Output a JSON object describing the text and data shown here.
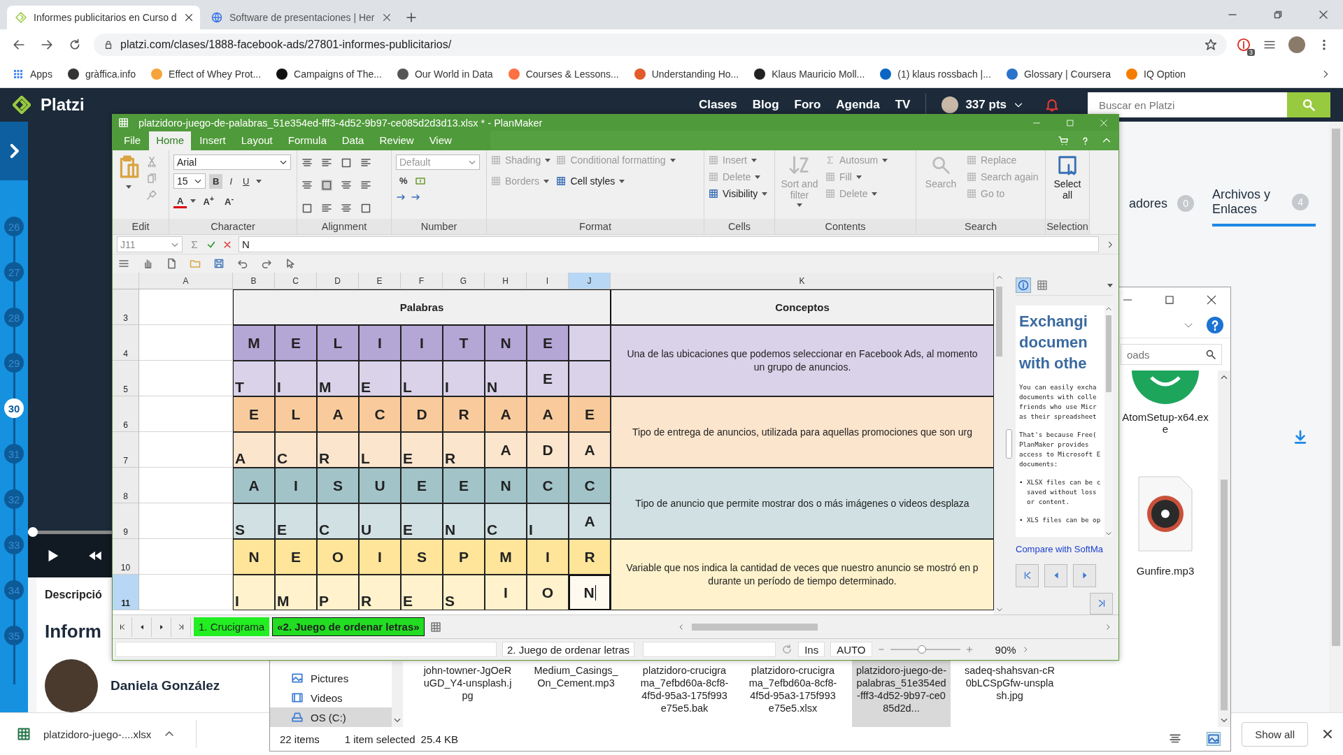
{
  "browser": {
    "tabs": [
      {
        "title": "Informes publicitarios en Curso d",
        "selected": true
      },
      {
        "title": "Software de presentaciones | Her",
        "selected": false
      }
    ],
    "address": "platzi.com/clases/1888-facebook-ads/27801-informes-publicitarios/",
    "extension_badge": "3",
    "bookmarks": [
      "Apps",
      "gràffica.info",
      "Effect of Whey Prot...",
      "Campaigns of The...",
      "Our World in Data",
      "Courses & Lessons...",
      "Understanding Ho...",
      "Klaus Mauricio Moll...",
      "(1) klaus rossbach |...",
      "Glossary | Coursera",
      "IQ Option"
    ]
  },
  "platzi": {
    "logo": "Platzi",
    "nav": [
      "Clases",
      "Blog",
      "Foro",
      "Agenda",
      "TV"
    ],
    "points": "337 pts",
    "search_placeholder": "Buscar en Platzi",
    "lessons": [
      {
        "number": "26",
        "selected": false
      },
      {
        "number": "27",
        "selected": false
      },
      {
        "number": "28",
        "selected": false
      },
      {
        "number": "29",
        "selected": false
      },
      {
        "number": "30",
        "selected": true
      },
      {
        "number": "31",
        "selected": false
      },
      {
        "number": "32",
        "selected": false
      },
      {
        "number": "33",
        "selected": false
      },
      {
        "number": "34",
        "selected": false
      },
      {
        "number": "35",
        "selected": false
      }
    ],
    "video_progress": {
      "level": 0.0
    },
    "description_tab": "Descripció",
    "title": "Inform",
    "author": "Daniela González",
    "side_tabs": [
      {
        "label": "adores",
        "count": "0",
        "selected": false
      },
      {
        "label": "Archivos y Enlaces",
        "count": "4",
        "selected": true
      }
    ]
  },
  "downloads": {
    "file": "platzidoro-juego-....xlsx",
    "show_all": "Show all"
  },
  "explorer": {
    "search_placeholder": "oads",
    "nav": [
      {
        "label": "Pictures",
        "selected": false
      },
      {
        "label": "Videos",
        "selected": false
      },
      {
        "label": "OS (C:)",
        "selected": true
      }
    ],
    "side_files": [
      {
        "name": "AtomSetup-x64.exe",
        "kind": "app"
      },
      {
        "name": "Gunfire.mp3",
        "kind": "audio"
      }
    ],
    "files": [
      {
        "name": "john-towner-JgOeRuGD_Y4-unsplash.jpg",
        "selected": false
      },
      {
        "name": "Medium_Casings_On_Cement.mp3",
        "selected": false
      },
      {
        "name": "platzidoro-crucigrama_7efbd60a-8cf8-4f5d-95a3-175f993e75e5.bak",
        "selected": false
      },
      {
        "name": "platzidoro-crucigrama_7efbd60a-8cf8-4f5d-95a3-175f993e75e5.xlsx",
        "selected": false
      },
      {
        "name": "platzidoro-juego-de-palabras_51e354ed-fff3-4d52-9b97-ce085d2d...",
        "selected": true
      },
      {
        "name": "sadeq-shahsvan-cR0bLCSpGfw-unsplash.jpg",
        "selected": false
      }
    ],
    "count": "22 items",
    "selection": "1 item selected",
    "size": "25.4 KB"
  },
  "planmaker": {
    "title": "platzidoro-juego-de-palabras_51e354ed-fff3-4d52-9b97-ce085d2d3d13.xlsx * - PlanMaker",
    "menu": [
      {
        "label": "File",
        "selected": false
      },
      {
        "label": "Home",
        "selected": true
      },
      {
        "label": "Insert",
        "selected": false
      },
      {
        "label": "Layout",
        "selected": false
      },
      {
        "label": "Formula",
        "selected": false
      },
      {
        "label": "Data",
        "selected": false
      },
      {
        "label": "Review",
        "selected": false
      },
      {
        "label": "View",
        "selected": false
      }
    ],
    "ribbon_groups": [
      {
        "kind": "edit",
        "label": "Edit"
      },
      {
        "kind": "character",
        "label": "Character",
        "font": "Arial",
        "size": "15",
        "styles": [
          {
            "label": "B",
            "selected": true
          },
          {
            "label": "I",
            "selected": false
          },
          {
            "label": "U",
            "selected": false
          }
        ],
        "font_color": "A",
        "grow": "A$^{+}$",
        "shrink": "A$^{-}$"
      },
      {
        "kind": "alignment",
        "label": "Alignment"
      },
      {
        "kind": "number",
        "label": "Number",
        "format": "Default",
        "percent": "%"
      },
      {
        "kind": "commands",
        "label": "Format",
        "columns": [
          [
            {
              "label": "Shading",
              "disabled": true,
              "dropdown": true
            },
            {
              "label": "Borders",
              "disabled": true,
              "dropdown": true
            }
          ],
          [
            {
              "label": "Conditional formatting",
              "disabled": true,
              "dropdown": true
            },
            {
              "label": "Cell styles",
              "disabled": false,
              "dropdown": true
            }
          ]
        ]
      },
      {
        "kind": "commands",
        "label": "Cells",
        "columns": [
          [
            {
              "label": "Insert",
              "disabled": true,
              "dropdown": true
            },
            {
              "label": "Delete",
              "disabled": true,
              "dropdown": true
            },
            {
              "label": "Visibility",
              "disabled": false,
              "dropdown": true
            }
          ]
        ]
      },
      {
        "kind": "commands",
        "label": "Contents",
        "large": {
          "label": "Sort and filter",
          "disabled": true,
          "dropdown": true
        },
        "columns": [
          [
            {
              "label": "Autosum",
              "disabled": true,
              "dropdown": true
            },
            {
              "label": "Fill",
              "disabled": true,
              "dropdown": true
            },
            {
              "label": "Delete",
              "disabled": true,
              "dropdown": true
            }
          ]
        ]
      },
      {
        "kind": "commands",
        "label": "Search",
        "large": {
          "label": "Search",
          "disabled": true,
          "dropdown": false
        },
        "columns": [
          [
            {
              "label": "Replace",
              "disabled": true,
              "dropdown": false
            },
            {
              "label": "Search again",
              "disabled": true,
              "dropdown": false
            },
            {
              "label": "Go to",
              "disabled": true,
              "dropdown": false
            }
          ]
        ]
      },
      {
        "kind": "commands",
        "label": "Selection",
        "large": {
          "label": "Select all",
          "disabled": false,
          "dropdown": false
        }
      }
    ],
    "formula": {
      "cell": "J11",
      "value": "N"
    },
    "columns": [
      {
        "label": "A",
        "selected": false
      },
      {
        "label": "B",
        "selected": false
      },
      {
        "label": "C",
        "selected": false
      },
      {
        "label": "D",
        "selected": false
      },
      {
        "label": "E",
        "selected": false
      },
      {
        "label": "F",
        "selected": false
      },
      {
        "label": "G",
        "selected": false
      },
      {
        "label": "H",
        "selected": false
      },
      {
        "label": "I",
        "selected": false
      },
      {
        "label": "J",
        "selected": true
      },
      {
        "label": "K",
        "selected": false
      }
    ],
    "header_row": {
      "row": "3",
      "selected": false,
      "words": "Palabras",
      "concepts": "Conceptos"
    },
    "groups": [
      {
        "color": "#d9d2e9",
        "concept": [
          "Una de las ubicaciones que podemos seleccionar en Facebook Ads, al momento",
          "un grupo de anuncios."
        ],
        "rows": [
          {
            "row": "4",
            "selected": false,
            "color": "#b4a7d6",
            "cells": [
              {
                "text": "M",
                "kind": "center"
              },
              {
                "text": "E",
                "kind": "center"
              },
              {
                "text": "L",
                "kind": "center"
              },
              {
                "text": "I",
                "kind": "center"
              },
              {
                "text": "I",
                "kind": "center"
              },
              {
                "text": "T",
                "kind": "center"
              },
              {
                "text": "N",
                "kind": "center"
              },
              {
                "text": "E",
                "kind": "center"
              },
              null
            ]
          },
          {
            "row": "5",
            "selected": false,
            "color": "#d9d2e9",
            "cells": [
              {
                "text": "T",
                "kind": "bottom"
              },
              {
                "text": "I",
                "kind": "bottom"
              },
              {
                "text": "M",
                "kind": "bottom"
              },
              {
                "text": "E",
                "kind": "bottom"
              },
              {
                "text": "L",
                "kind": "bottom"
              },
              {
                "text": "I",
                "kind": "bottom"
              },
              {
                "text": "N",
                "kind": "bottom"
              },
              {
                "text": "E",
                "kind": "center"
              },
              null
            ]
          }
        ]
      },
      {
        "color": "#fce5cd",
        "concept": [
          "Tipo de entrega de anuncios, utilizada para aquellas promociones que son urg"
        ],
        "rows": [
          {
            "row": "6",
            "selected": false,
            "color": "#f9cb9c",
            "cells": [
              {
                "text": "E",
                "kind": "center"
              },
              {
                "text": "L",
                "kind": "center"
              },
              {
                "text": "A",
                "kind": "center"
              },
              {
                "text": "C",
                "kind": "center"
              },
              {
                "text": "D",
                "kind": "center"
              },
              {
                "text": "R",
                "kind": "center"
              },
              {
                "text": "A",
                "kind": "center"
              },
              {
                "text": "A",
                "kind": "center"
              },
              {
                "text": "E",
                "kind": "center"
              }
            ]
          },
          {
            "row": "7",
            "selected": false,
            "color": "#fce5cd",
            "cells": [
              {
                "text": "A",
                "kind": "bottom"
              },
              {
                "text": "C",
                "kind": "bottom"
              },
              {
                "text": "R",
                "kind": "bottom"
              },
              {
                "text": "L",
                "kind": "bottom"
              },
              {
                "text": "E",
                "kind": "bottom"
              },
              {
                "text": "R",
                "kind": "bottom"
              },
              {
                "text": "A",
                "kind": "center"
              },
              {
                "text": "D",
                "kind": "center"
              },
              {
                "text": "A",
                "kind": "center"
              }
            ]
          }
        ]
      },
      {
        "color": "#d0e0e3",
        "concept": [
          "Tipo de anuncio que permite mostrar dos o más imágenes o videos desplaza"
        ],
        "rows": [
          {
            "row": "8",
            "selected": false,
            "color": "#a2c4c9",
            "cells": [
              {
                "text": "A",
                "kind": "center"
              },
              {
                "text": "I",
                "kind": "center"
              },
              {
                "text": "S",
                "kind": "center"
              },
              {
                "text": "U",
                "kind": "center"
              },
              {
                "text": "E",
                "kind": "center"
              },
              {
                "text": "E",
                "kind": "center"
              },
              {
                "text": "N",
                "kind": "center"
              },
              {
                "text": "C",
                "kind": "center"
              },
              {
                "text": "C",
                "kind": "center"
              }
            ]
          },
          {
            "row": "9",
            "selected": false,
            "color": "#d0e0e3",
            "cells": [
              {
                "text": "S",
                "kind": "bottom"
              },
              {
                "text": "E",
                "kind": "bottom"
              },
              {
                "text": "C",
                "kind": "bottom"
              },
              {
                "text": "U",
                "kind": "bottom"
              },
              {
                "text": "E",
                "kind": "bottom"
              },
              {
                "text": "N",
                "kind": "bottom"
              },
              {
                "text": "C",
                "kind": "bottom"
              },
              {
                "text": "I",
                "kind": "bottom"
              },
              {
                "text": "A",
                "kind": "center"
              }
            ]
          }
        ]
      },
      {
        "color": "#fff2cc",
        "concept": [
          "Variable que nos indica la cantidad de veces que nuestro anuncio se mostró en p",
          "durante un período de tiempo determinado."
        ],
        "rows": [
          {
            "row": "10",
            "selected": false,
            "color": "#ffe599",
            "cells": [
              {
                "text": "N",
                "kind": "center"
              },
              {
                "text": "E",
                "kind": "center"
              },
              {
                "text": "O",
                "kind": "center"
              },
              {
                "text": "I",
                "kind": "center"
              },
              {
                "text": "S",
                "kind": "center"
              },
              {
                "text": "P",
                "kind": "center"
              },
              {
                "text": "M",
                "kind": "center"
              },
              {
                "text": "I",
                "kind": "center"
              },
              {
                "text": "R",
                "kind": "center"
              }
            ]
          },
          {
            "row": "11",
            "selected": true,
            "color": "#fff2cc",
            "cells": [
              {
                "text": "I",
                "kind": "bottom"
              },
              {
                "text": "M",
                "kind": "bottom"
              },
              {
                "text": "P",
                "kind": "bottom"
              },
              {
                "text": "R",
                "kind": "bottom"
              },
              {
                "text": "E",
                "kind": "bottom"
              },
              {
                "text": "S",
                "kind": "bottom"
              },
              {
                "text": "I",
                "kind": "center"
              },
              {
                "text": "O",
                "kind": "center"
              },
              {
                "text": "N",
                "kind": "center"
              }
            ]
          }
        ]
      }
    ],
    "side_panel": {
      "tabs": [
        {
          "kind": "info",
          "selected": true
        },
        {
          "kind": "table",
          "selected": false
        }
      ],
      "heading": [
        "Exchangi",
        "documen",
        "with othe"
      ],
      "paragraphs": [
        [
          "You can easily excha",
          "documents with colle",
          "friends who use Micr",
          "as their spreadsheet"
        ],
        [
          "That's because Free(",
          "PlanMaker provides",
          "access to Microsoft E",
          "documents:"
        ],
        [
          "• XLSX files can be c",
          "  saved without loss",
          "  or content."
        ],
        [
          "• XLS files can be op"
        ]
      ],
      "link": "Compare with SoftMa"
    },
    "sheet_tabs": [
      {
        "label": "1. Crucigrama",
        "selected": false
      },
      {
        "label": "«2. Juego de ordenar letras»",
        "selected": true
      }
    ],
    "status": {
      "sheet": "2. Juego de ordenar letras",
      "mode": "Ins",
      "calc": "AUTO",
      "zoom": {
        "level": 0.45
      },
      "zoom_text": "90%"
    }
  }
}
